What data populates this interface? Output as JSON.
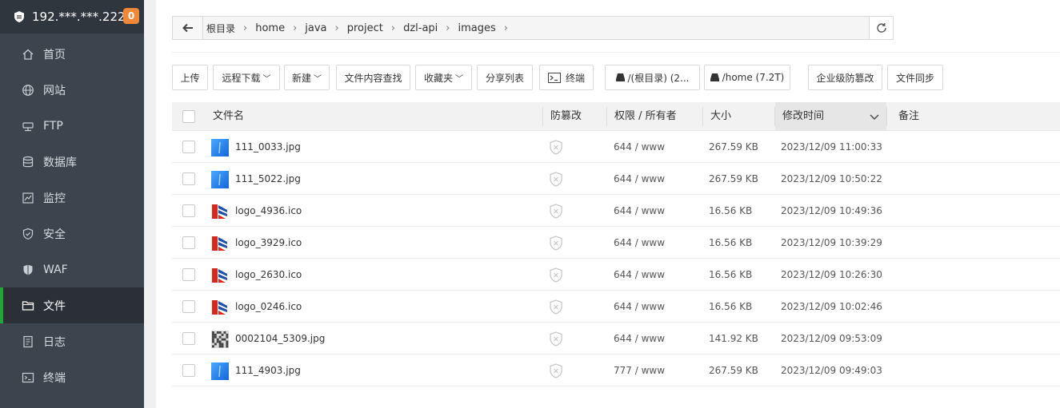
{
  "server": {
    "ip": "192.***.***.222",
    "badge": "0"
  },
  "sidebar": {
    "items": [
      {
        "label": "首页",
        "icon": "home-icon"
      },
      {
        "label": "网站",
        "icon": "globe-icon"
      },
      {
        "label": "FTP",
        "icon": "ftp-icon"
      },
      {
        "label": "数据库",
        "icon": "database-icon"
      },
      {
        "label": "监控",
        "icon": "monitor-icon"
      },
      {
        "label": "安全",
        "icon": "shield-icon"
      },
      {
        "label": "WAF",
        "icon": "waf-shield-icon"
      },
      {
        "label": "文件",
        "icon": "folder-icon",
        "active": true
      },
      {
        "label": "日志",
        "icon": "log-icon"
      },
      {
        "label": "终端",
        "icon": "terminal-icon"
      }
    ]
  },
  "path": {
    "root": "根目录",
    "segments": [
      "home",
      "java",
      "project",
      "dzl-api",
      "images"
    ]
  },
  "toolbar": {
    "upload": "上传",
    "remote_download": "远程下载",
    "new": "新建",
    "content_search": "文件内容查找",
    "favorites": "收藏夹",
    "share_list": "分享列表",
    "terminal": "终端",
    "disk_root": "/(根目录) (2...",
    "disk_home": "/home (7.2T)",
    "tamper_proof": "企业级防篡改",
    "file_sync": "文件同步"
  },
  "table": {
    "headers": {
      "name": "文件名",
      "tamper": "防篡改",
      "perm": "权限 / 所有者",
      "size": "大小",
      "mtime": "修改时间",
      "note": "备注"
    },
    "rows": [
      {
        "name": "111_0033.jpg",
        "type": "jpg-blue",
        "perm": "644 / www",
        "size": "267.59 KB",
        "mtime": "2023/12/09 11:00:33"
      },
      {
        "name": "111_5022.jpg",
        "type": "jpg-blue",
        "perm": "644 / www",
        "size": "267.59 KB",
        "mtime": "2023/12/09 10:50:22"
      },
      {
        "name": "logo_4936.ico",
        "type": "ico-logo",
        "perm": "644 / www",
        "size": "16.56 KB",
        "mtime": "2023/12/09 10:49:36"
      },
      {
        "name": "logo_3929.ico",
        "type": "ico-logo",
        "perm": "644 / www",
        "size": "16.56 KB",
        "mtime": "2023/12/09 10:39:29"
      },
      {
        "name": "logo_2630.ico",
        "type": "ico-logo",
        "perm": "644 / www",
        "size": "16.56 KB",
        "mtime": "2023/12/09 10:26:30"
      },
      {
        "name": "logo_0246.ico",
        "type": "ico-logo",
        "perm": "644 / www",
        "size": "16.56 KB",
        "mtime": "2023/12/09 10:02:46"
      },
      {
        "name": "0002104_5309.jpg",
        "type": "jpg-qr",
        "perm": "644 / www",
        "size": "141.92 KB",
        "mtime": "2023/12/09 09:53:09"
      },
      {
        "name": "111_4903.jpg",
        "type": "jpg-blue",
        "perm": "777 / www",
        "size": "267.59 KB",
        "mtime": "2023/12/09 09:49:03"
      }
    ]
  },
  "colors": {
    "sidebar_bg": "#3c444d",
    "active_accent": "#20a53a",
    "badge": "#f0883a"
  }
}
